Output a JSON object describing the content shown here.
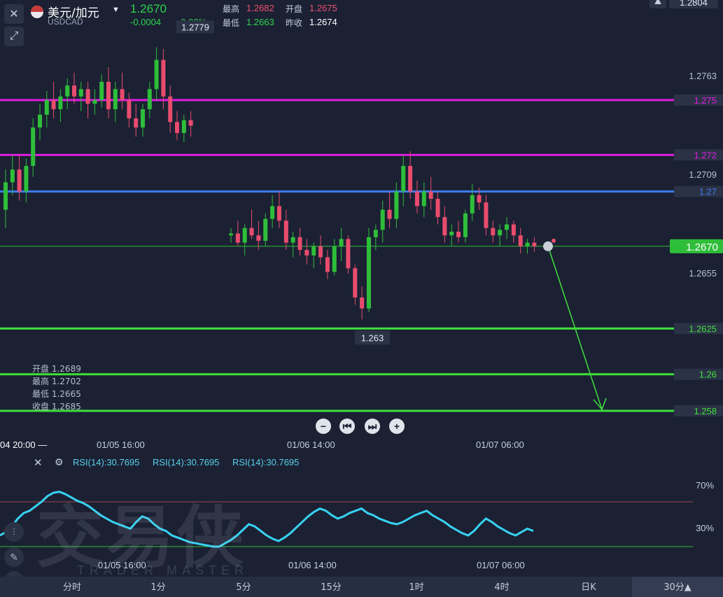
{
  "header": {
    "pair_name": "美元/加元",
    "symbol": "USDCAD",
    "last_price": "1.2670",
    "change": "-0.0004",
    "change_pct": "-0.03%",
    "high_label": "最高",
    "high_value": "1.2682",
    "open_label": "开盘",
    "open_value": "1.2675",
    "low_label": "最低",
    "low_value": "1.2663",
    "prev_close_label": "昨收",
    "prev_close_value": "1.2674",
    "top_axis_value": "1.2804"
  },
  "ohlc_box": {
    "open_label": "开盘",
    "open": "1.2689",
    "high_label": "最高",
    "high": "1.2702",
    "low_label": "最低",
    "low": "1.2665",
    "close_label": "收盘",
    "close": "1.2685"
  },
  "crosshair_time": "04 20:00 —",
  "time_labels": [
    "01/05 16:00",
    "01/06 14:00",
    "01/07 06:00"
  ],
  "rsi": {
    "labels": [
      "RSI(14):30.7695",
      "RSI(14):30.7695",
      "RSI(14):30.7695"
    ],
    "upper_label": "70%",
    "lower_label": "30%",
    "time_labels": [
      "01/05 16:00",
      "01/06 14:00",
      "01/07 06:00"
    ]
  },
  "watermark": {
    "text": "交易侠",
    "sub": "TRADER MASTER"
  },
  "timeframes": [
    "分时",
    "1分",
    "5分",
    "15分",
    "1时",
    "4时",
    "日K",
    "30分▲"
  ],
  "colors": {
    "up": "#2fbe3a",
    "down": "#e84c6e",
    "magenta": "#e01be0",
    "blue": "#3d7df2",
    "green": "#3fe03b",
    "rsi": "#38d3f2"
  },
  "chart_data": {
    "type": "candlestick",
    "yrange": [
      1.2575,
      1.2804
    ],
    "axis_ticks": [
      "1.2804",
      "1.2763",
      "1.2709",
      "1.2655"
    ],
    "current_price": "1.2670",
    "annotations": {
      "max": "1.2779",
      "min": "1.263"
    },
    "horizontal_lines": [
      {
        "value": 1.275,
        "label": "1.275",
        "color": "#e01be0"
      },
      {
        "value": 1.272,
        "label": "1.272",
        "color": "#e01be0"
      },
      {
        "value": 1.27,
        "label": "1.27",
        "color": "#3d7df2"
      },
      {
        "value": 1.2625,
        "label": "1.2625",
        "color": "#3fe03b"
      },
      {
        "value": 1.26,
        "label": "1.26",
        "color": "#3fe03b"
      },
      {
        "value": 1.258,
        "label": "1.258",
        "color": "#3fe03b"
      }
    ],
    "arrow": {
      "from": 1.267,
      "to": 1.258
    },
    "candles": [
      [
        1.269,
        1.2712,
        1.268,
        1.2705
      ],
      [
        1.2705,
        1.272,
        1.2698,
        1.2712
      ],
      [
        1.2712,
        1.272,
        1.2695,
        1.27
      ],
      [
        1.27,
        1.2718,
        1.2694,
        1.2714
      ],
      [
        1.2714,
        1.274,
        1.2708,
        1.2735
      ],
      [
        1.2735,
        1.2748,
        1.2728,
        1.2742
      ],
      [
        1.2742,
        1.2755,
        1.2735,
        1.275
      ],
      [
        1.275,
        1.276,
        1.274,
        1.2745
      ],
      [
        1.2745,
        1.2756,
        1.2738,
        1.2752
      ],
      [
        1.2752,
        1.2762,
        1.2745,
        1.2758
      ],
      [
        1.2758,
        1.2765,
        1.2748,
        1.2752
      ],
      [
        1.2752,
        1.276,
        1.2744,
        1.2756
      ],
      [
        1.2756,
        1.276,
        1.274,
        1.2748
      ],
      [
        1.2748,
        1.2756,
        1.2742,
        1.275
      ],
      [
        1.275,
        1.2764,
        1.2746,
        1.276
      ],
      [
        1.276,
        1.2768,
        1.274,
        1.2745
      ],
      [
        1.2745,
        1.276,
        1.2738,
        1.2756
      ],
      [
        1.2756,
        1.2765,
        1.2745,
        1.275
      ],
      [
        1.275,
        1.2754,
        1.2735,
        1.274
      ],
      [
        1.274,
        1.2748,
        1.273,
        1.2735
      ],
      [
        1.2735,
        1.2748,
        1.273,
        1.2745
      ],
      [
        1.2745,
        1.276,
        1.274,
        1.2756
      ],
      [
        1.2756,
        1.2779,
        1.275,
        1.2772
      ],
      [
        1.2772,
        1.2778,
        1.2745,
        1.2752
      ],
      [
        1.2752,
        1.2758,
        1.2732,
        1.2738
      ],
      [
        1.2738,
        1.2744,
        1.2728,
        1.2732
      ],
      [
        1.2732,
        1.2742,
        1.2727,
        1.2739
      ],
      [
        1.2739,
        1.2744,
        1.273,
        1.2736
      ],
      [
        1.2676,
        1.268,
        1.2672,
        1.2677
      ],
      [
        1.2677,
        1.2684,
        1.267,
        1.2672
      ],
      [
        1.2672,
        1.2682,
        1.2665,
        1.268
      ],
      [
        1.268,
        1.269,
        1.2674,
        1.2676
      ],
      [
        1.2676,
        1.2684,
        1.2668,
        1.2673
      ],
      [
        1.2673,
        1.2688,
        1.267,
        1.2685
      ],
      [
        1.2685,
        1.2698,
        1.268,
        1.2692
      ],
      [
        1.2692,
        1.27,
        1.268,
        1.2684
      ],
      [
        1.2684,
        1.269,
        1.2668,
        1.2672
      ],
      [
        1.2672,
        1.2678,
        1.2664,
        1.2675
      ],
      [
        1.2675,
        1.268,
        1.2665,
        1.2668
      ],
      [
        1.2668,
        1.2674,
        1.266,
        1.2665
      ],
      [
        1.2665,
        1.2672,
        1.2658,
        1.267
      ],
      [
        1.267,
        1.2676,
        1.266,
        1.2664
      ],
      [
        1.2664,
        1.2668,
        1.2652,
        1.2656
      ],
      [
        1.2656,
        1.2674,
        1.2654,
        1.267
      ],
      [
        1.267,
        1.268,
        1.2662,
        1.2674
      ],
      [
        1.2674,
        1.2676,
        1.2655,
        1.2658
      ],
      [
        1.2658,
        1.266,
        1.2638,
        1.2642
      ],
      [
        1.2642,
        1.2648,
        1.263,
        1.2636
      ],
      [
        1.2636,
        1.268,
        1.2634,
        1.2675
      ],
      [
        1.2675,
        1.2682,
        1.2668,
        1.2679
      ],
      [
        1.2679,
        1.2695,
        1.2672,
        1.269
      ],
      [
        1.269,
        1.27,
        1.268,
        1.2685
      ],
      [
        1.2685,
        1.2705,
        1.268,
        1.27
      ],
      [
        1.27,
        1.272,
        1.2692,
        1.2714
      ],
      [
        1.2714,
        1.2722,
        1.2696,
        1.27
      ],
      [
        1.27,
        1.2706,
        1.2688,
        1.2692
      ],
      [
        1.2692,
        1.2705,
        1.2686,
        1.27
      ],
      [
        1.27,
        1.2708,
        1.269,
        1.2696
      ],
      [
        1.2696,
        1.27,
        1.2682,
        1.2686
      ],
      [
        1.2686,
        1.2692,
        1.2672,
        1.2676
      ],
      [
        1.2676,
        1.2682,
        1.267,
        1.2678
      ],
      [
        1.2678,
        1.2684,
        1.2672,
        1.2675
      ],
      [
        1.2675,
        1.269,
        1.2672,
        1.2688
      ],
      [
        1.2688,
        1.2704,
        1.2684,
        1.2698
      ],
      [
        1.2698,
        1.2702,
        1.269,
        1.2694
      ],
      [
        1.2694,
        1.2698,
        1.2676,
        1.268
      ],
      [
        1.268,
        1.2684,
        1.2672,
        1.2676
      ],
      [
        1.2676,
        1.2682,
        1.267,
        1.2679
      ],
      [
        1.2679,
        1.2686,
        1.2674,
        1.2682
      ],
      [
        1.2682,
        1.2684,
        1.2672,
        1.2676
      ],
      [
        1.2676,
        1.268,
        1.2666,
        1.267
      ],
      [
        1.267,
        1.2674,
        1.2666,
        1.2672
      ],
      [
        1.2672,
        1.2675,
        1.2667,
        1.267
      ]
    ],
    "rsi_values": [
      40,
      43,
      48,
      55,
      60,
      62,
      66,
      70,
      75,
      78,
      79,
      77,
      74,
      71,
      69,
      66,
      62,
      58,
      55,
      52,
      50,
      48,
      46,
      52,
      57,
      55,
      50,
      46,
      44,
      40,
      38,
      36,
      34,
      33,
      32,
      31,
      30,
      30,
      33,
      36,
      40,
      45,
      50,
      48,
      44,
      40,
      37,
      35,
      38,
      42,
      47,
      52,
      57,
      61,
      64,
      62,
      58,
      55,
      57,
      60,
      62,
      64,
      60,
      58,
      55,
      53,
      51,
      50,
      52,
      55,
      58,
      60,
      62,
      58,
      55,
      52,
      48,
      45,
      42,
      40,
      44,
      50,
      55,
      52,
      48,
      45,
      42,
      40,
      43,
      46,
      44
    ]
  }
}
